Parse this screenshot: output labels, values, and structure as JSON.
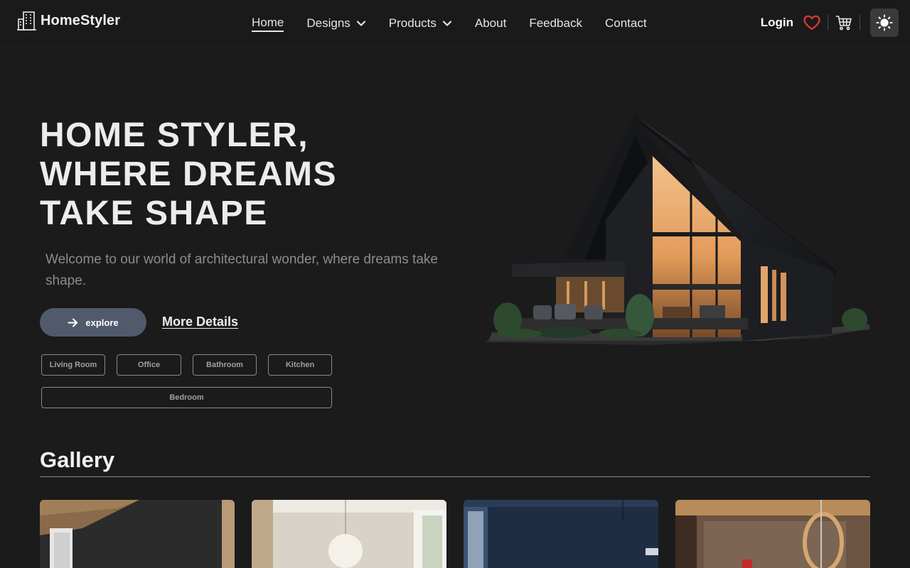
{
  "brand": {
    "name": "HomeStyler"
  },
  "nav": {
    "items": [
      {
        "label": "Home",
        "active": true,
        "dropdown": false
      },
      {
        "label": "Designs",
        "active": false,
        "dropdown": true
      },
      {
        "label": "Products",
        "active": false,
        "dropdown": true
      },
      {
        "label": "About",
        "active": false,
        "dropdown": false
      },
      {
        "label": "Feedback",
        "active": false,
        "dropdown": false
      },
      {
        "label": "Contact",
        "active": false,
        "dropdown": false
      }
    ],
    "login_label": "Login",
    "icons": [
      "heart-icon",
      "cart-icon",
      "sun-icon"
    ],
    "heart_color": "#e53935"
  },
  "hero": {
    "title_line1": "HOME STYLER,",
    "title_line2": "WHERE DREAMS",
    "title_line3": "TAKE SHAPE",
    "subtitle": "Welcome to our world of architectural wonder, where dreams take shape.",
    "explore_label": "explore",
    "more_label": "More Details",
    "chips": [
      "Living Room",
      "Office",
      "Bathroom",
      "Kitchen",
      "Bedroom"
    ]
  },
  "gallery": {
    "title": "Gallery",
    "cards": [
      "gallery-image-dark-room",
      "gallery-image-white-room",
      "gallery-image-blue-room",
      "gallery-image-stone-stair"
    ]
  },
  "colors": {
    "background": "#1b1b1b",
    "button": "#515a6d",
    "subtitle_text": "#8c8c8c"
  }
}
